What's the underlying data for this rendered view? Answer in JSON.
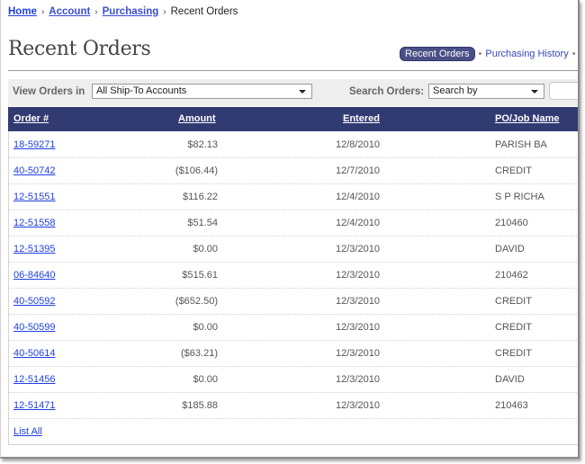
{
  "breadcrumb": {
    "items": [
      {
        "label": "Home"
      },
      {
        "label": "Account"
      },
      {
        "label": "Purchasing"
      }
    ],
    "current": "Recent Orders",
    "separator": "›"
  },
  "page": {
    "title": "Recent Orders"
  },
  "subnav": {
    "active": "Recent Orders",
    "links": [
      {
        "label": "Purchasing History"
      }
    ],
    "bullet": "•"
  },
  "filters": {
    "view_label": "View Orders in",
    "view_value": "All Ship-To Accounts",
    "search_label": "Search Orders:",
    "search_value": "Search by",
    "search_text": ""
  },
  "table": {
    "columns": [
      "Order #",
      "Amount",
      "Entered",
      "PO/Job Name"
    ],
    "rows": [
      {
        "order": "18-59271",
        "amount": "$82.13",
        "entered": "12/8/2010",
        "po": "PARISH BA"
      },
      {
        "order": "40-50742",
        "amount": "($106.44)",
        "entered": "12/7/2010",
        "po": "CREDIT"
      },
      {
        "order": "12-51551",
        "amount": "$116.22",
        "entered": "12/4/2010",
        "po": "S P RICHA"
      },
      {
        "order": "12-51558",
        "amount": "$51.54",
        "entered": "12/4/2010",
        "po": "210460"
      },
      {
        "order": "12-51395",
        "amount": "$0.00",
        "entered": "12/3/2010",
        "po": "DAVID"
      },
      {
        "order": "06-84640",
        "amount": "$515.61",
        "entered": "12/3/2010",
        "po": "210462"
      },
      {
        "order": "40-50592",
        "amount": "($652.50)",
        "entered": "12/3/2010",
        "po": "CREDIT"
      },
      {
        "order": "40-50599",
        "amount": "$0.00",
        "entered": "12/3/2010",
        "po": "CREDIT"
      },
      {
        "order": "40-50614",
        "amount": "($63.21)",
        "entered": "12/3/2010",
        "po": "CREDIT"
      },
      {
        "order": "12-51456",
        "amount": "$0.00",
        "entered": "12/3/2010",
        "po": "DAVID"
      },
      {
        "order": "12-51471",
        "amount": "$185.88",
        "entered": "12/3/2010",
        "po": "210463"
      }
    ]
  },
  "footer": {
    "list_all": "List All"
  },
  "colors": {
    "header_bg": "#323a72",
    "link": "#1f3fe0",
    "pill_bg": "#4a4f86"
  }
}
